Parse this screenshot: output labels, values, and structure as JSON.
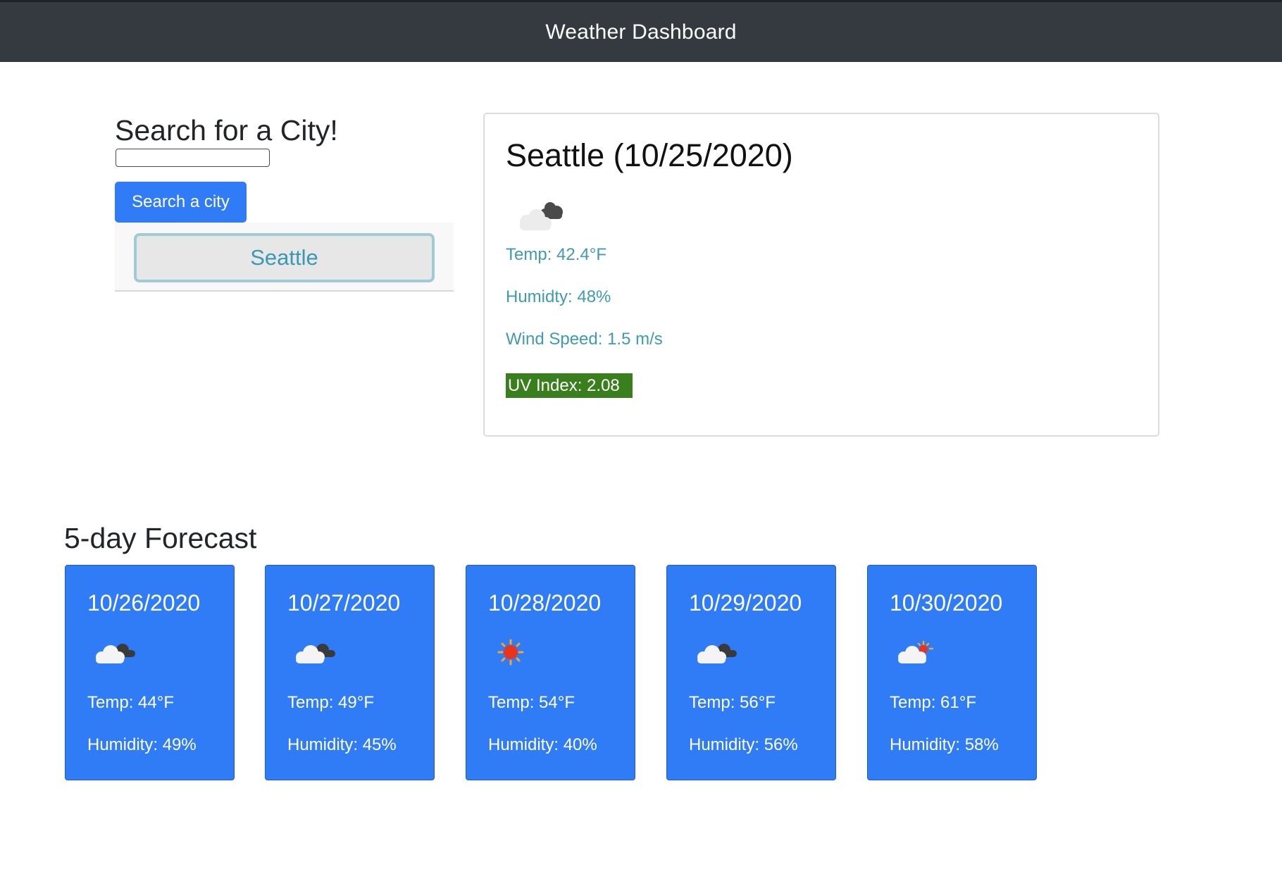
{
  "navbar": {
    "title": "Weather Dashboard"
  },
  "search": {
    "heading": "Search for a City!",
    "input_value": "",
    "input_placeholder": "",
    "button_label": "Search a city",
    "history": [
      "Seattle"
    ]
  },
  "current": {
    "title": "Seattle (10/25/2020)",
    "icon": "broken-clouds-icon",
    "temp": "Temp: 42.4°F",
    "humidity": "Humidty: 48%",
    "wind": "Wind Speed: 1.5 m/s",
    "uv": "UV Index: 2.08",
    "uv_color": "#3a7f1d"
  },
  "forecast": {
    "heading": "5-day Forecast",
    "days": [
      {
        "date": "10/26/2020",
        "icon": "cloudy-icon",
        "temp": "Temp: 44°F",
        "humidity": "Humidity: 49%"
      },
      {
        "date": "10/27/2020",
        "icon": "cloudy-icon",
        "temp": "Temp: 49°F",
        "humidity": "Humidity: 45%"
      },
      {
        "date": "10/28/2020",
        "icon": "sun-icon",
        "temp": "Temp: 54°F",
        "humidity": "Humidity: 40%"
      },
      {
        "date": "10/29/2020",
        "icon": "cloudy-icon",
        "temp": "Temp: 56°F",
        "humidity": "Humidity: 56%"
      },
      {
        "date": "10/30/2020",
        "icon": "partly-sunny-icon",
        "temp": "Temp: 61°F",
        "humidity": "Humidity: 58%"
      }
    ]
  },
  "colors": {
    "navbar_bg": "#343a40",
    "primary": "#2f7cf6",
    "info_text": "#3f9bb0"
  }
}
